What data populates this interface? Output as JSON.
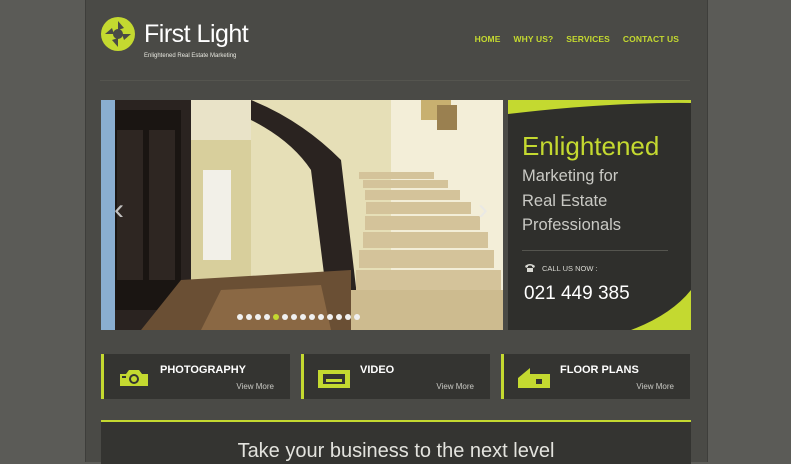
{
  "brand": {
    "name": "First Light",
    "tagline": "Enlightened Real Estate Marketing"
  },
  "nav": [
    "HOME",
    "WHY US?",
    "SERVICES",
    "CONTACT US"
  ],
  "slider": {
    "dot_count": 14,
    "active_index": 4
  },
  "promo": {
    "title": "Enlightened",
    "subtitle_lines": [
      "Marketing for",
      "Real Estate",
      "Professionals"
    ],
    "call_label": "CALL US NOW :",
    "phone": "021 449 385"
  },
  "features": [
    {
      "label": "PHOTOGRAPHY",
      "more": "View More",
      "icon": "camera-icon"
    },
    {
      "label": "VIDEO",
      "more": "View More",
      "icon": "video-icon"
    },
    {
      "label": "FLOOR PLANS",
      "more": "View More",
      "icon": "house-icon"
    }
  ],
  "cta": {
    "text": "Take your business to the next level"
  },
  "colors": {
    "accent": "#c4d930",
    "panel": "#343431",
    "background": "#4a4a46"
  }
}
